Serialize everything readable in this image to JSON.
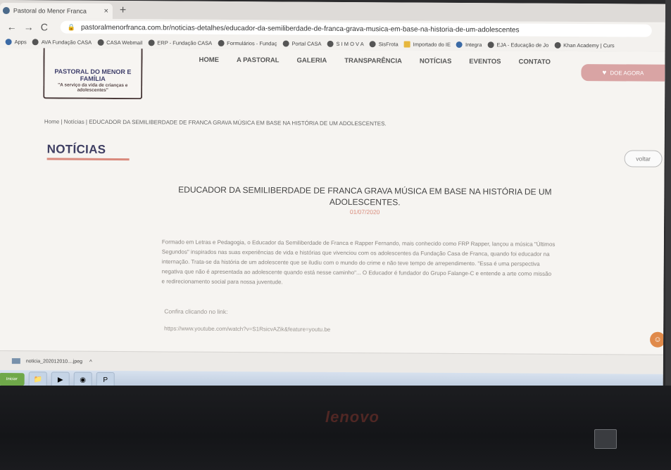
{
  "browser": {
    "tab_title": "Pastoral do Menor Franca",
    "tab_close": "×",
    "new_tab": "+",
    "url": "pastoralmenorfranca.com.br/noticias-detalhes/educador-da-semiliberdade-de-franca-grava-musica-em-base-na-historia-de-um-adolescentes",
    "bookmarks": [
      "Apps",
      "AVA Fundação CASA",
      "CASA Webmail",
      "ERP - Fundação CASA",
      "Formulários - Fundaç",
      "Portal CASA",
      "S I M O V A",
      "SisFrota",
      "Importado do IE",
      "Integra",
      "EJA - Educação de Jo",
      "Khan Academy | Curs"
    ]
  },
  "site": {
    "logo_name": "PASTORAL DO MENOR E FAMÍLIA",
    "logo_tagline": "\"A serviço da vida de crianças e adolescentes\"",
    "nav": [
      "HOME",
      "A PASTORAL",
      "GALERIA",
      "TRANSPARÊNCIA",
      "NOTÍCIAS",
      "EVENTOS",
      "CONTATO"
    ],
    "donate_label": "DOE AGORA"
  },
  "article": {
    "breadcrumb": "Home | Notícias | EDUCADOR DA SEMILIBERDADE DE FRANCA GRAVA MÚSICA EM BASE NA HISTÓRIA DE UM ADOLESCENTES.",
    "section_title": "NOTÍCIAS",
    "back_label": "voltar",
    "headline": "EDUCADOR DA SEMILIBERDADE DE FRANCA GRAVA MÚSICA EM BASE NA HISTÓRIA DE UM ADOLESCENTES.",
    "date": "01/07/2020",
    "body": "Formado em Letras e Pedagogia, o Educador da Semiliberdade de Franca e Rapper Fernando, mais conhecido como FRP Rapper, lançou a música \"Últimos Segundos\" inspirados nas suas experiências de vida e histórias que vivenciou com os adolescentes da Fundação Casa de Franca, quando foi educador na internação. Trata-se da história de um adolescente que se iludiu com o mundo do crime e não teve tempo de arrependimento. \"Essa é uma perspectiva negativa que não é apresentada ao adolescente quando está nesse caminho\"... O Educador é fundador do Grupo Falange-C e entende a arte como missão e redirecionamento social para nossa juventude.",
    "cta": "Confira clicando no link:",
    "link": "https://www.youtube.com/watch?v=S1RsicvAZik&feature=youtu.be"
  },
  "downloads": {
    "file": "noticia_202012010....jpeg",
    "chevron": "^"
  },
  "taskbar": {
    "start_label": "Iniciar"
  },
  "hardware": {
    "brand": "lenovo"
  }
}
